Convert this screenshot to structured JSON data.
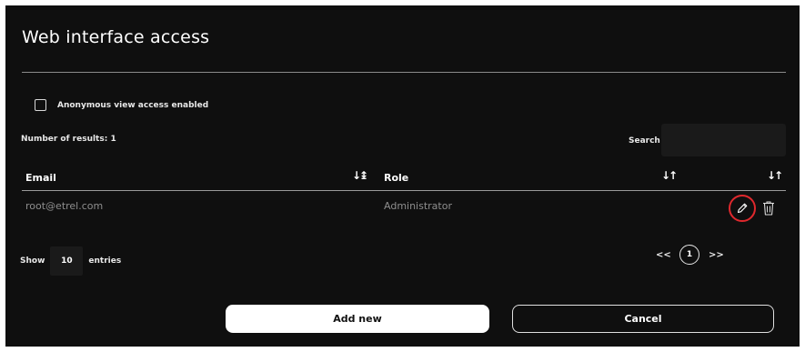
{
  "dialog": {
    "title": "Web interface access"
  },
  "anonymous": {
    "label": "Anonymous view access enabled",
    "checked": false
  },
  "results": {
    "text": "Number of results: 1"
  },
  "search": {
    "label": "Search",
    "value": "",
    "placeholder": ""
  },
  "table": {
    "columns": [
      "Email",
      "Role"
    ],
    "rows": [
      {
        "email": "root@etrel.com",
        "role": "Administrator"
      }
    ]
  },
  "icons": {
    "sort_email": "sort-alpha-down-icon",
    "sort_role": "sort-icon",
    "sort_actions": "sort-icon",
    "edit": "pencil-icon",
    "delete": "trash-icon"
  },
  "length_menu": {
    "show_label": "Show",
    "value": "10",
    "entries_label": "entries"
  },
  "pagination": {
    "prev": "<<",
    "current": "1",
    "next": ">>"
  },
  "buttons": {
    "add_new": "Add new",
    "cancel": "Cancel"
  },
  "colors": {
    "background": "#0f0f0f",
    "highlight": "#e0282d",
    "text_muted": "#8e8e8e"
  }
}
